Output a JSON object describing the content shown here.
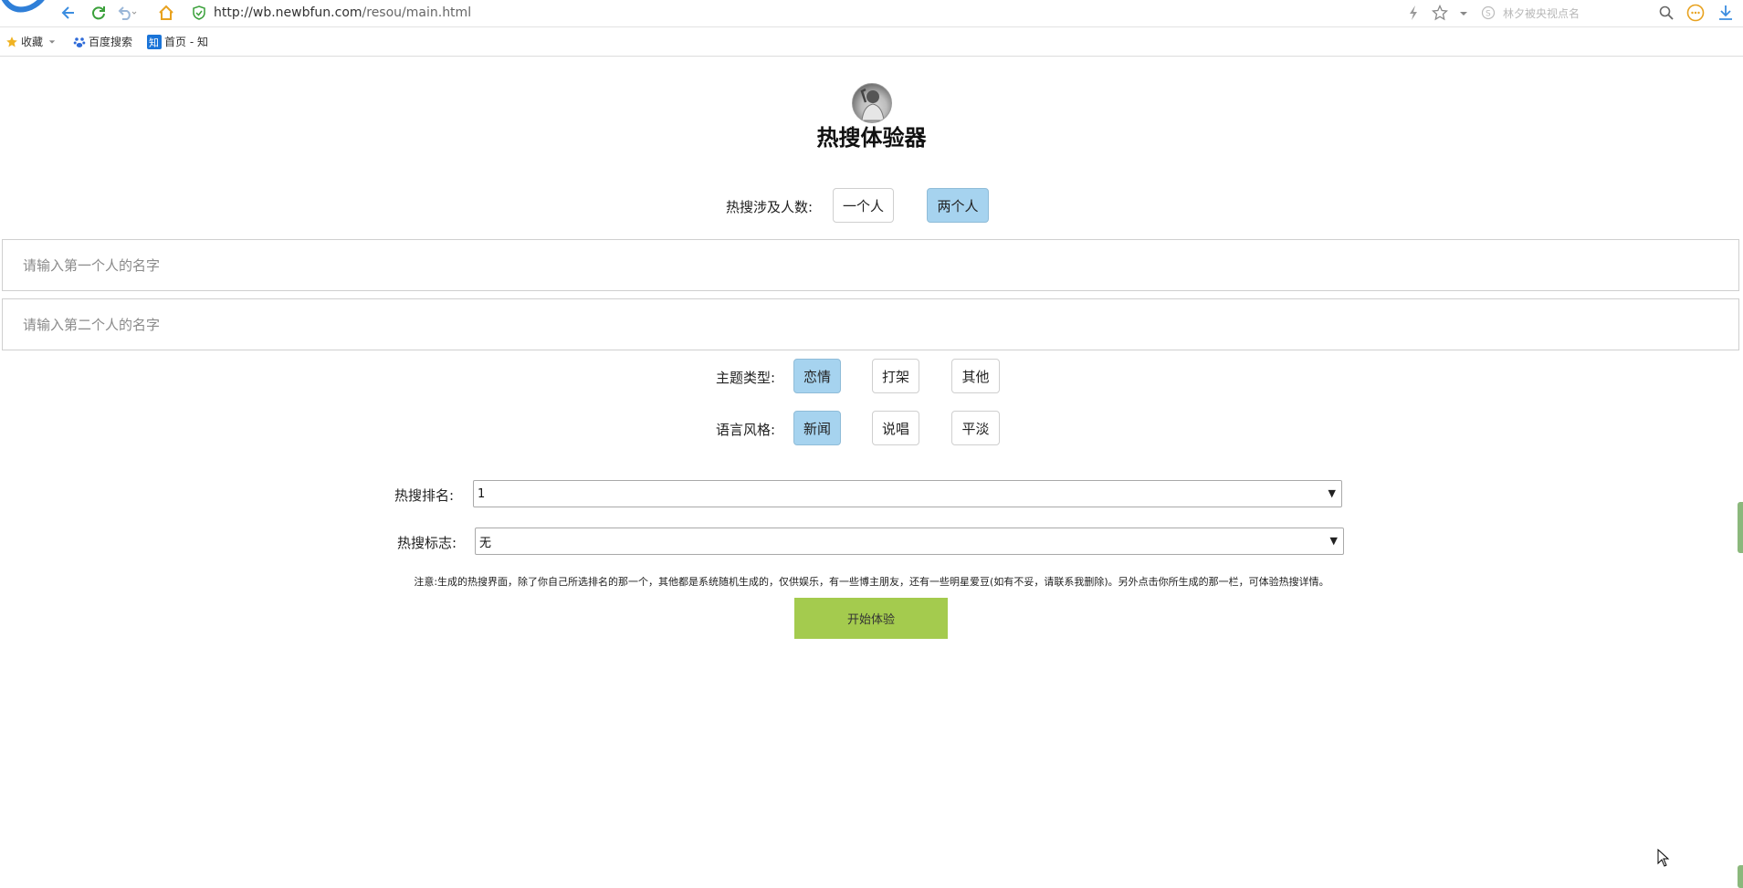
{
  "browser": {
    "url_host": "http://wb.newbfun.com",
    "url_path": "/resou/main.html",
    "search_placeholder": "林夕被央视点名"
  },
  "bookmarks": [
    {
      "label": "收藏"
    },
    {
      "label": "百度搜索"
    },
    {
      "label": "首页 - 知"
    }
  ],
  "page": {
    "title": "热搜体验器",
    "people": {
      "label": "热搜涉及人数:",
      "options": [
        "一个人",
        "两个人"
      ],
      "selected": "两个人"
    },
    "name1_placeholder": "请输入第一个人的名字",
    "name2_placeholder": "请输入第二个人的名字",
    "theme": {
      "label": "主题类型:",
      "options": [
        "恋情",
        "打架",
        "其他"
      ],
      "selected": "恋情"
    },
    "style": {
      "label": "语言风格:",
      "options": [
        "新闻",
        "说唱",
        "平淡"
      ],
      "selected": "新闻"
    },
    "rank": {
      "label": "热搜排名:",
      "value": "1"
    },
    "flag": {
      "label": "热搜标志:",
      "value": "无"
    },
    "notice": "注意:生成的热搜界面，除了你自己所选排名的那一个，其他都是系统随机生成的，仅供娱乐，有一些博主朋友，还有一些明星爱豆(如有不妥，请联系我删除)。另外点击你所生成的那一栏，可体验热搜详情。",
    "start_label": "开始体验"
  },
  "colors": {
    "active_option": "#a6d3ef",
    "start_button": "#a4cb4e",
    "nav_icon": "#3b8de0"
  }
}
